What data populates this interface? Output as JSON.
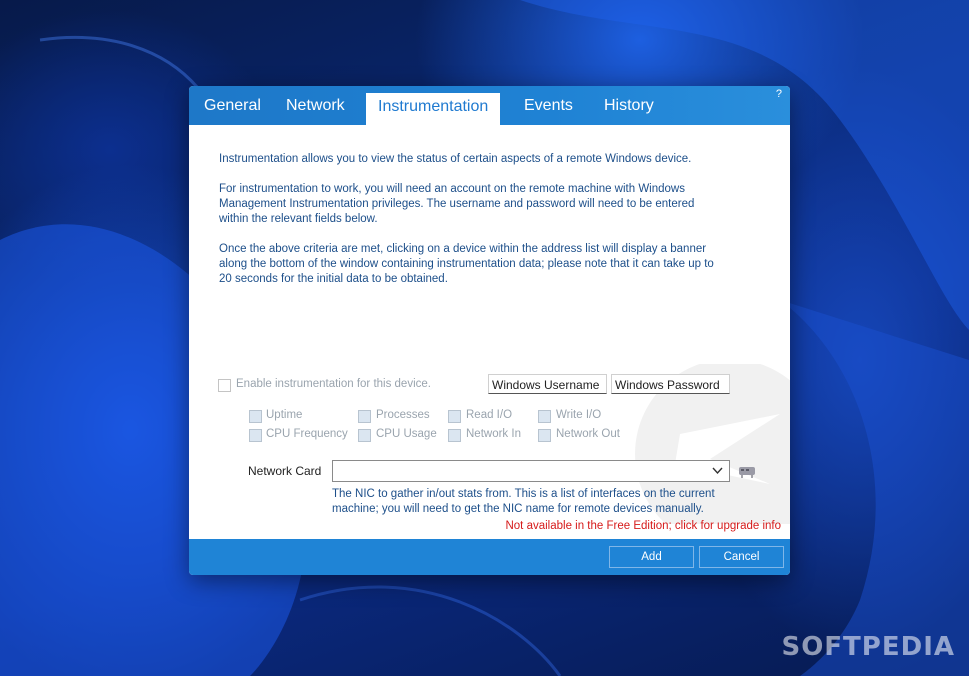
{
  "dialog": {
    "help_label": "?",
    "tabs": [
      {
        "label": "General"
      },
      {
        "label": "Network"
      },
      {
        "label": "Instrumentation"
      },
      {
        "label": "Events"
      },
      {
        "label": "History"
      }
    ],
    "active_tab": "Instrumentation",
    "description": [
      "Instrumentation allows you to view the status of certain aspects of a remote Windows device.",
      "For instrumentation to work, you will need an account on the remote machine with Windows Management Instrumentation privileges. The username and password will need to be entered within the relevant fields below.",
      "Once the above criteria are met, clicking on a device within the address list will display a banner along the bottom of the window containing instrumentation data; please note that it can take up to 20 seconds for the initial data to be obtained."
    ],
    "enable_label": "Enable instrumentation for this device.",
    "username_placeholder": "Windows Username",
    "password_placeholder": "Windows Password",
    "metrics": [
      {
        "label": "Uptime"
      },
      {
        "label": "Processes"
      },
      {
        "label": "Read I/O"
      },
      {
        "label": "Write I/O"
      },
      {
        "label": "CPU Frequency"
      },
      {
        "label": "CPU Usage"
      },
      {
        "label": "Network In"
      },
      {
        "label": "Network Out"
      }
    ],
    "network_card_label": "Network Card",
    "network_card_value": "",
    "nic_hint": "The NIC to gather in/out stats from. This is a list of interfaces on the current machine; you will need to get the NIC name for remote devices manually.",
    "upgrade_text": "Not available in the Free Edition; click for upgrade info",
    "add_label": "Add",
    "cancel_label": "Cancel"
  },
  "watermark": "SOFTPEDIA",
  "colors": {
    "accent": "#1f84d6",
    "link_text": "#1d4f8a",
    "warning": "#d61a1a"
  }
}
